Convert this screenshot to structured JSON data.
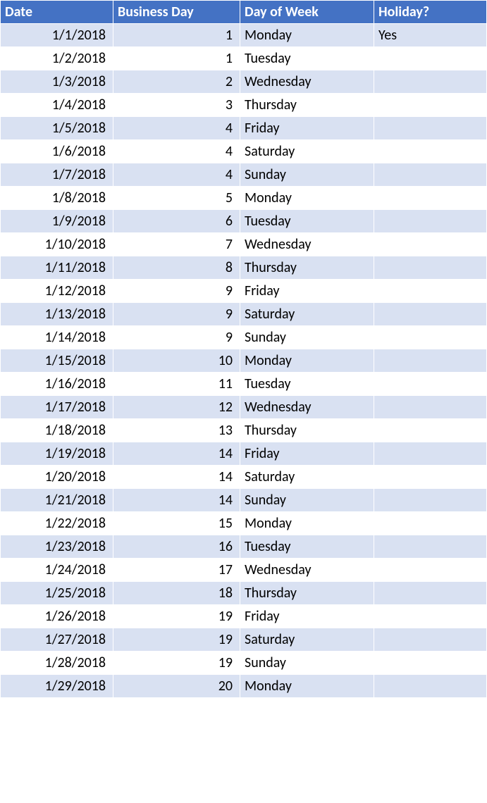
{
  "headers": {
    "date": "Date",
    "business_day": "Business Day",
    "day_of_week": "Day of Week",
    "holiday": "Holiday?"
  },
  "rows": [
    {
      "date": "1/1/2018",
      "business_day": "1",
      "day_of_week": "Monday",
      "holiday": "Yes"
    },
    {
      "date": "1/2/2018",
      "business_day": "1",
      "day_of_week": "Tuesday",
      "holiday": ""
    },
    {
      "date": "1/3/2018",
      "business_day": "2",
      "day_of_week": "Wednesday",
      "holiday": ""
    },
    {
      "date": "1/4/2018",
      "business_day": "3",
      "day_of_week": "Thursday",
      "holiday": ""
    },
    {
      "date": "1/5/2018",
      "business_day": "4",
      "day_of_week": "Friday",
      "holiday": ""
    },
    {
      "date": "1/6/2018",
      "business_day": "4",
      "day_of_week": "Saturday",
      "holiday": ""
    },
    {
      "date": "1/7/2018",
      "business_day": "4",
      "day_of_week": "Sunday",
      "holiday": ""
    },
    {
      "date": "1/8/2018",
      "business_day": "5",
      "day_of_week": "Monday",
      "holiday": ""
    },
    {
      "date": "1/9/2018",
      "business_day": "6",
      "day_of_week": "Tuesday",
      "holiday": ""
    },
    {
      "date": "1/10/2018",
      "business_day": "7",
      "day_of_week": "Wednesday",
      "holiday": ""
    },
    {
      "date": "1/11/2018",
      "business_day": "8",
      "day_of_week": "Thursday",
      "holiday": ""
    },
    {
      "date": "1/12/2018",
      "business_day": "9",
      "day_of_week": "Friday",
      "holiday": ""
    },
    {
      "date": "1/13/2018",
      "business_day": "9",
      "day_of_week": "Saturday",
      "holiday": ""
    },
    {
      "date": "1/14/2018",
      "business_day": "9",
      "day_of_week": "Sunday",
      "holiday": ""
    },
    {
      "date": "1/15/2018",
      "business_day": "10",
      "day_of_week": "Monday",
      "holiday": ""
    },
    {
      "date": "1/16/2018",
      "business_day": "11",
      "day_of_week": "Tuesday",
      "holiday": ""
    },
    {
      "date": "1/17/2018",
      "business_day": "12",
      "day_of_week": "Wednesday",
      "holiday": ""
    },
    {
      "date": "1/18/2018",
      "business_day": "13",
      "day_of_week": "Thursday",
      "holiday": ""
    },
    {
      "date": "1/19/2018",
      "business_day": "14",
      "day_of_week": "Friday",
      "holiday": ""
    },
    {
      "date": "1/20/2018",
      "business_day": "14",
      "day_of_week": "Saturday",
      "holiday": ""
    },
    {
      "date": "1/21/2018",
      "business_day": "14",
      "day_of_week": "Sunday",
      "holiday": ""
    },
    {
      "date": "1/22/2018",
      "business_day": "15",
      "day_of_week": "Monday",
      "holiday": ""
    },
    {
      "date": "1/23/2018",
      "business_day": "16",
      "day_of_week": "Tuesday",
      "holiday": ""
    },
    {
      "date": "1/24/2018",
      "business_day": "17",
      "day_of_week": "Wednesday",
      "holiday": ""
    },
    {
      "date": "1/25/2018",
      "business_day": "18",
      "day_of_week": "Thursday",
      "holiday": ""
    },
    {
      "date": "1/26/2018",
      "business_day": "19",
      "day_of_week": "Friday",
      "holiday": ""
    },
    {
      "date": "1/27/2018",
      "business_day": "19",
      "day_of_week": "Saturday",
      "holiday": ""
    },
    {
      "date": "1/28/2018",
      "business_day": "19",
      "day_of_week": "Sunday",
      "holiday": ""
    },
    {
      "date": "1/29/2018",
      "business_day": "20",
      "day_of_week": "Monday",
      "holiday": ""
    }
  ]
}
